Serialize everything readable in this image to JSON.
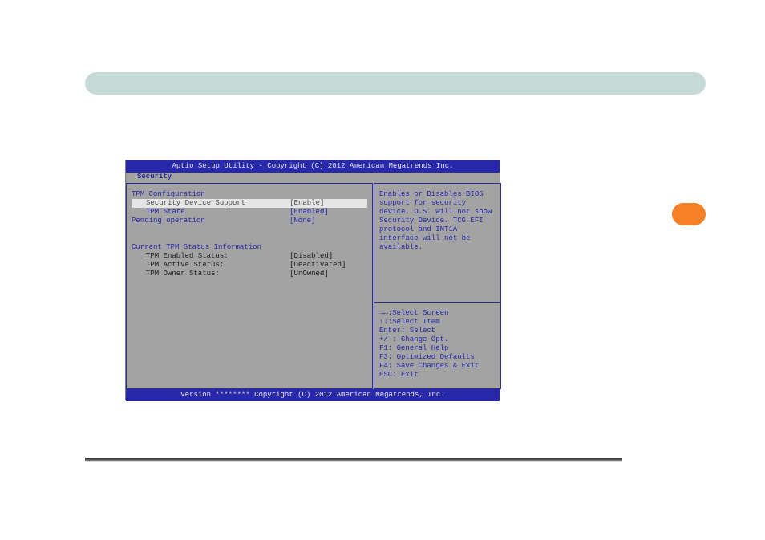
{
  "bios": {
    "title": "Aptio Setup Utility - Copyright (C) 2012 American Megatrends Inc.",
    "tab": "Security",
    "footer": "Version ******** Copyright (C) 2012 American Megatrends, Inc.",
    "left": {
      "group1_title": "TPM Configuration",
      "row_selected": {
        "label": "Security Device Support",
        "value": "[Enable]"
      },
      "row_tpm_state": {
        "label": "TPM State",
        "value": "[Enabled]"
      },
      "row_pending": {
        "label": "Pending operation",
        "value": "[None]"
      },
      "group2_title": "Current TPM Status Information",
      "row_enabled": {
        "label": "TPM Enabled Status:",
        "value": "[Disabled]"
      },
      "row_active": {
        "label": "TPM Active Status:",
        "value": "[Deactivated]"
      },
      "row_owner": {
        "label": "TPM Owner Status:",
        "value": "[UnOwned]"
      }
    },
    "help": "Enables or Disables BIOS support for security device. O.S. will not show Security Device. TCG EFI protocol and INT1A interface will not be available.",
    "keys": {
      "k1": "→←:Select Screen",
      "k2": "↑↓:Select Item",
      "k3": "Enter: Select",
      "k4": "+/-: Change Opt.",
      "k5": "F1: General Help",
      "k6": "F3: Optimized Defaults",
      "k7": "F4: Save Changes & Exit",
      "k8": "ESC: Exit"
    }
  }
}
